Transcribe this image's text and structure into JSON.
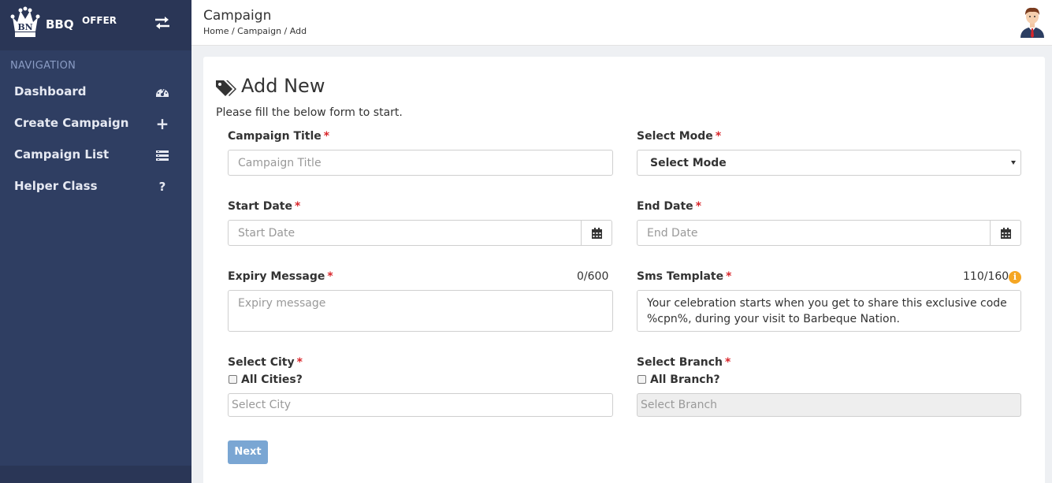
{
  "sidebar": {
    "brand": {
      "name": "BBQ",
      "sup": "OFFER",
      "logo_text": "BN"
    },
    "nav_title": "NAVIGATION",
    "items": [
      {
        "label": "Dashboard",
        "icon": "dashboard-gauge-icon"
      },
      {
        "label": "Create Campaign",
        "icon": "plus-icon"
      },
      {
        "label": "Campaign List",
        "icon": "list-icon"
      },
      {
        "label": "Helper Class",
        "icon": "question-icon",
        "glyph": "?"
      }
    ],
    "plus_glyph": "+"
  },
  "header": {
    "title": "Campaign",
    "breadcrumb": "Home / Campaign / Add"
  },
  "card": {
    "title": "Add New",
    "subtitle": "Please fill the below form to start."
  },
  "form": {
    "campaign_title": {
      "label": "Campaign Title",
      "placeholder": "Campaign Title"
    },
    "select_mode": {
      "label": "Select Mode",
      "value": "Select Mode"
    },
    "start_date": {
      "label": "Start Date",
      "placeholder": "Start Date"
    },
    "end_date": {
      "label": "End Date",
      "placeholder": "End Date"
    },
    "expiry_message": {
      "label": "Expiry Message",
      "placeholder": "Expiry message",
      "counter": "0/600"
    },
    "sms_template": {
      "label": "Sms Template",
      "counter": "110/160",
      "value": "Your celebration starts when you get to share this exclusive code %cpn%, during your visit to Barbeque Nation."
    },
    "select_city": {
      "label": "Select City",
      "checkbox_label": "All Cities?",
      "placeholder": "Select City"
    },
    "select_branch": {
      "label": "Select Branch",
      "checkbox_label": "All Branch?",
      "placeholder": "Select Branch"
    },
    "required_mark": "*",
    "next_label": "Next"
  },
  "colors": {
    "sidebar_bg": "#2f3e62",
    "brand_bar_bg": "#2a3656",
    "nav_title": "#8a9cc4",
    "required": "#d9262b",
    "next_button": "#7aa6d3",
    "info_icon": "#f5a623"
  }
}
